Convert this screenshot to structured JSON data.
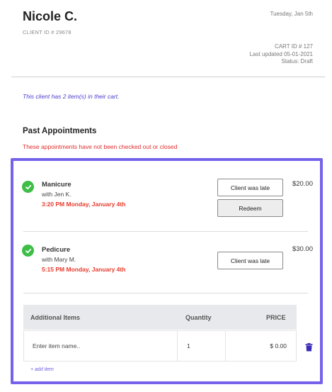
{
  "client": {
    "name": "Nicole C.",
    "id_label": "CLIENT ID # 29678",
    "date": "Tuesday, Jan 5th"
  },
  "cart": {
    "id_label": "CART ID # 127",
    "updated": "Last updated 05-01-2021",
    "status": "Status: Draft",
    "note": "This client has 2 item(s) in their cart."
  },
  "past_appointments": {
    "title": "Past Appointments",
    "warning": "These appointments have not been checked out or closed",
    "items": [
      {
        "service": "Manicure",
        "staff": "with Jen K.",
        "time": "3:20 PM Monday, January 4th",
        "price": "$20.00",
        "late_button": "Client was late",
        "redeem_button": "Redeem"
      },
      {
        "service": "Pedicure",
        "staff": "with Mary M.",
        "time": "5:15 PM Monday, January 4th",
        "price": "$30.00",
        "late_button": "Client was late"
      }
    ]
  },
  "additional_items": {
    "headers": {
      "item": "Additional Items",
      "quantity": "Quantity",
      "price": "PRICE"
    },
    "row": {
      "name_placeholder": "Enter item name..",
      "quantity": "1",
      "price": "$ 0.00"
    },
    "add_link": "+ add item"
  },
  "colors": {
    "accent": "#7463ea",
    "check": "#3dbe47",
    "warning": "#e02b2b",
    "time": "#e83a2c",
    "delete": "#3b2bb8"
  }
}
